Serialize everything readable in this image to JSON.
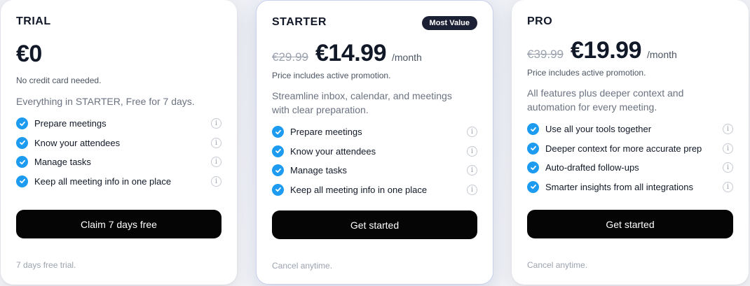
{
  "plans": [
    {
      "name": "TRIAL",
      "old_price": "",
      "price": "€0",
      "period": "",
      "note": "No credit card needed.",
      "description": "Everything in STARTER, Free for 7 days.",
      "features": [
        "Prepare meetings",
        "Know your attendees",
        "Manage tasks",
        "Keep all meeting info in one place"
      ],
      "cta": "Claim 7 days free",
      "footnote": "7 days free trial."
    },
    {
      "name": "STARTER",
      "badge": "Most Value",
      "old_price": "€29.99",
      "price": "€14.99",
      "period": "/month",
      "note": "Price includes active promotion.",
      "description": "Streamline inbox, calendar, and meetings with clear preparation.",
      "features": [
        "Prepare meetings",
        "Know your attendees",
        "Manage tasks",
        "Keep all meeting info in one place"
      ],
      "cta": "Get started",
      "footnote": "Cancel anytime."
    },
    {
      "name": "PRO",
      "old_price": "€39.99",
      "price": "€19.99",
      "period": "/month",
      "note": "Price includes active promotion.",
      "description": "All features plus deeper context and automation for every meeting.",
      "features": [
        "Use all your tools together",
        "Deeper context for more accurate prep",
        "Auto-drafted follow-ups",
        "Smarter insights from all integrations"
      ],
      "cta": "Get started",
      "footnote": "Cancel anytime."
    }
  ],
  "icons": {
    "check": "check-circle-icon",
    "info": "info-icon",
    "info_glyph": "i"
  },
  "colors": {
    "accent": "#1d9bf0",
    "button": "#050505",
    "badge": "#1c2035"
  }
}
